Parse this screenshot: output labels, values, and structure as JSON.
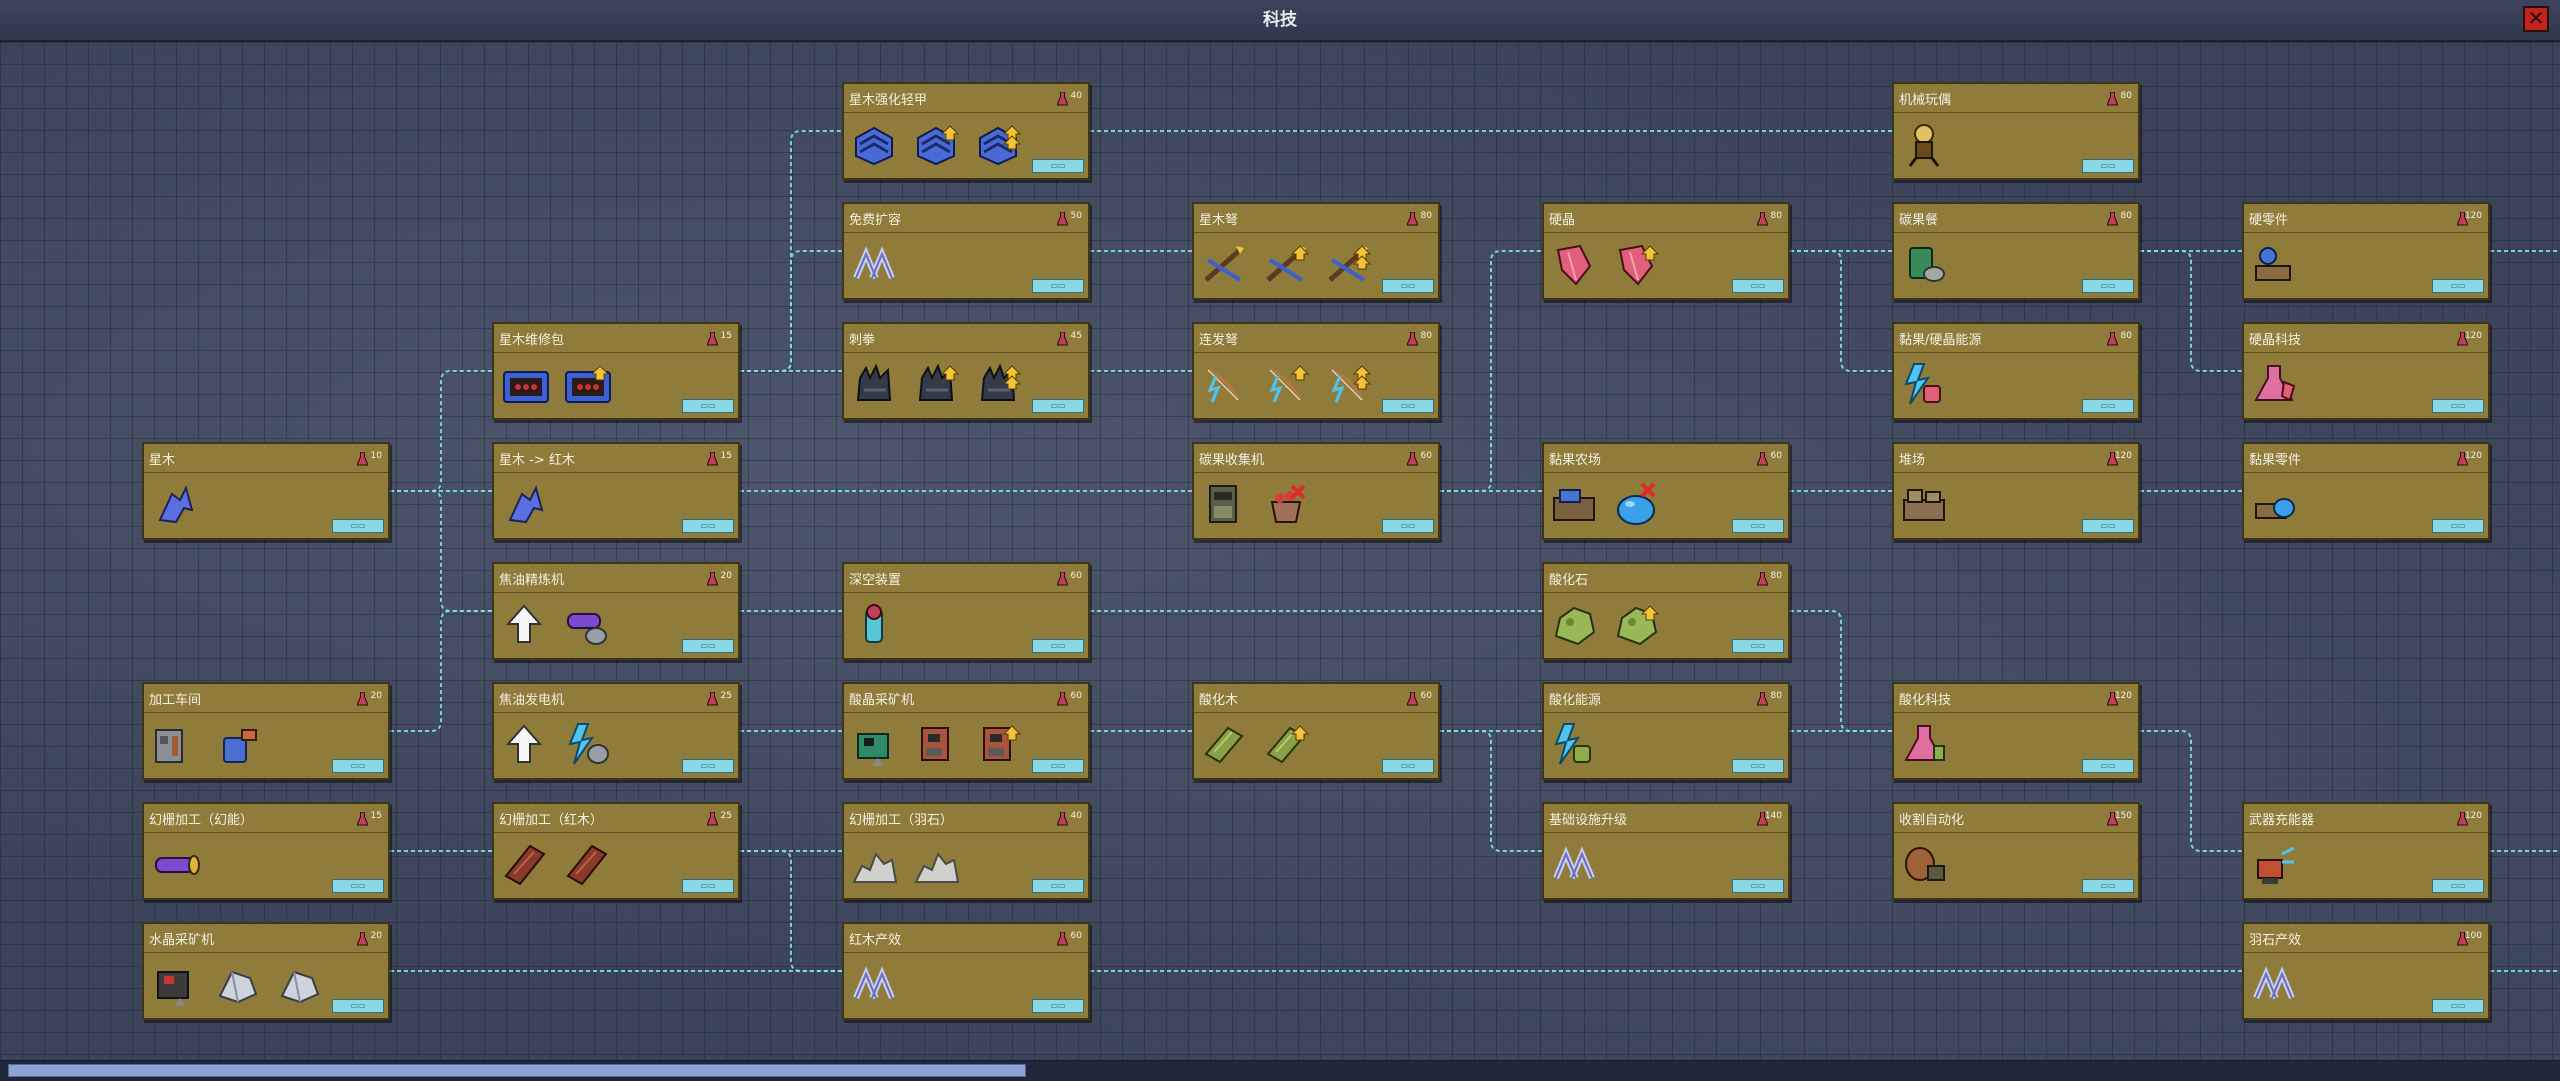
{
  "window": {
    "title": "科技",
    "close_icon": "close-icon"
  },
  "scrollbar": {
    "position": 0.0,
    "visible_fraction": 0.4
  },
  "colors": {
    "card": "#8f7c3b",
    "link": "#7fe0e8",
    "badge": "#88d8e6",
    "flask": "#c0405a"
  },
  "nodes": [
    {
      "id": "xingmu",
      "name": "星木",
      "cost": "10",
      "icons": [
        "blue-arrow"
      ]
    },
    {
      "id": "jiagong",
      "name": "加工车间",
      "cost": "20",
      "icons": [
        "workshop",
        "spray-bottle"
      ]
    },
    {
      "id": "huanmeng-hn",
      "name": "幻栅加工（幻能）",
      "cost": "15",
      "icons": [
        "purple-cylinder"
      ]
    },
    {
      "id": "shuijing",
      "name": "水晶采矿机",
      "cost": "20",
      "icons": [
        "drill",
        "crystal",
        "crystal"
      ]
    },
    {
      "id": "weixiubao",
      "name": "星木维修包",
      "cost": "15",
      "icons": [
        "blue-toolbox",
        "blue-toolbox-plus"
      ]
    },
    {
      "id": "xm-hm",
      "name": "星木 -> 红木",
      "cost": "15",
      "icons": [
        "blue-arrow"
      ]
    },
    {
      "id": "jiaoyou-jl",
      "name": "焦油精炼机",
      "cost": "20",
      "icons": [
        "white-arrow-up",
        "barrel-cylinder"
      ]
    },
    {
      "id": "jiaoyou-fd",
      "name": "焦油发电机",
      "cost": "25",
      "icons": [
        "white-arrow-up",
        "lightning-barrel"
      ]
    },
    {
      "id": "huanmeng-hm",
      "name": "幻栅加工（红木）",
      "cost": "25",
      "icons": [
        "red-plank",
        "red-plank"
      ]
    },
    {
      "id": "qingjia",
      "name": "星木强化轻甲",
      "cost": "40",
      "icons": [
        "blue-armor",
        "blue-armor-plus",
        "blue-armor-plus2"
      ]
    },
    {
      "id": "kuorong",
      "name": "免费扩容",
      "cost": "50",
      "icons": [
        "double-arrow"
      ]
    },
    {
      "id": "ciquan",
      "name": "刺拳",
      "cost": "45",
      "icons": [
        "spike-fist",
        "spike-fist-plus",
        "spike-fist-plus2"
      ]
    },
    {
      "id": "shenkong",
      "name": "深空装置",
      "cost": "60",
      "icons": [
        "deep-device"
      ]
    },
    {
      "id": "suanjing",
      "name": "酸晶采矿机",
      "cost": "60",
      "icons": [
        "green-drill",
        "red-drill",
        "red-drill-plus"
      ]
    },
    {
      "id": "yushi-jg",
      "name": "幻栅加工（羽石）",
      "cost": "40",
      "icons": [
        "stone-pile",
        "stone-pile"
      ]
    },
    {
      "id": "hongmu-cx",
      "name": "红木产效",
      "cost": "60",
      "icons": [
        "double-arrow"
      ]
    },
    {
      "id": "xingmu-nu",
      "name": "星木弩",
      "cost": "80",
      "icons": [
        "crossbow",
        "crossbow-plus",
        "crossbow-plus2"
      ]
    },
    {
      "id": "lianfa-nu",
      "name": "连发弩",
      "cost": "80",
      "icons": [
        "lightning-bow",
        "lightning-bow-plus",
        "lightning-bow-plus2"
      ]
    },
    {
      "id": "ranguo-sj",
      "name": "碳果收集机",
      "cost": "60",
      "icons": [
        "collector",
        "berry-basket"
      ]
    },
    {
      "id": "suanhua-mu",
      "name": "酸化木",
      "cost": "60",
      "icons": [
        "green-plank",
        "green-plank-plus"
      ]
    },
    {
      "id": "yingjing",
      "name": "硬晶",
      "cost": "80",
      "icons": [
        "pink-crystal",
        "pink-crystal-plus"
      ]
    },
    {
      "id": "nianguo-nc",
      "name": "黏果农场",
      "cost": "60",
      "icons": [
        "farm",
        "blue-blob"
      ]
    },
    {
      "id": "suanhua-shi",
      "name": "酸化石",
      "cost": "80",
      "icons": [
        "green-stone",
        "green-stone-plus"
      ]
    },
    {
      "id": "suanhua-ny",
      "name": "酸化能源",
      "cost": "80",
      "icons": [
        "lightning-green"
      ]
    },
    {
      "id": "jichu-sj",
      "name": "基础设施升级",
      "cost": "140",
      "icons": [
        "double-arrow"
      ]
    },
    {
      "id": "jixie-wo",
      "name": "机械玩偶",
      "cost": "80",
      "icons": [
        "mech-doll"
      ]
    },
    {
      "id": "ranguo-can",
      "name": "碳果餐",
      "cost": "80",
      "icons": [
        "green-can"
      ]
    },
    {
      "id": "nianguo-ny",
      "name": "黏果/硬晶能源",
      "cost": "80",
      "icons": [
        "lightning-pink"
      ]
    },
    {
      "id": "duichang",
      "name": "堆场",
      "cost": "120",
      "icons": [
        "storage"
      ]
    },
    {
      "id": "suanhua-kj",
      "name": "酸化科技",
      "cost": "120",
      "icons": [
        "flask-pink"
      ]
    },
    {
      "id": "shouge-zd",
      "name": "收割自动化",
      "cost": "150",
      "icons": [
        "harvester"
      ]
    },
    {
      "id": "ying-lj",
      "name": "硬零件",
      "cost": "120",
      "icons": [
        "parts-blue"
      ]
    },
    {
      "id": "yingjing-kj",
      "name": "硬晶科技",
      "cost": "120",
      "icons": [
        "flask-crystal"
      ]
    },
    {
      "id": "nianguo-lj",
      "name": "黏果零件",
      "cost": "120",
      "icons": [
        "parts-blob"
      ]
    },
    {
      "id": "wuqi-cn",
      "name": "武器充能器",
      "cost": "120",
      "icons": [
        "charger"
      ]
    },
    {
      "id": "yushi-cx",
      "name": "羽石产效",
      "cost": "100",
      "icons": [
        "double-arrow"
      ]
    }
  ]
}
